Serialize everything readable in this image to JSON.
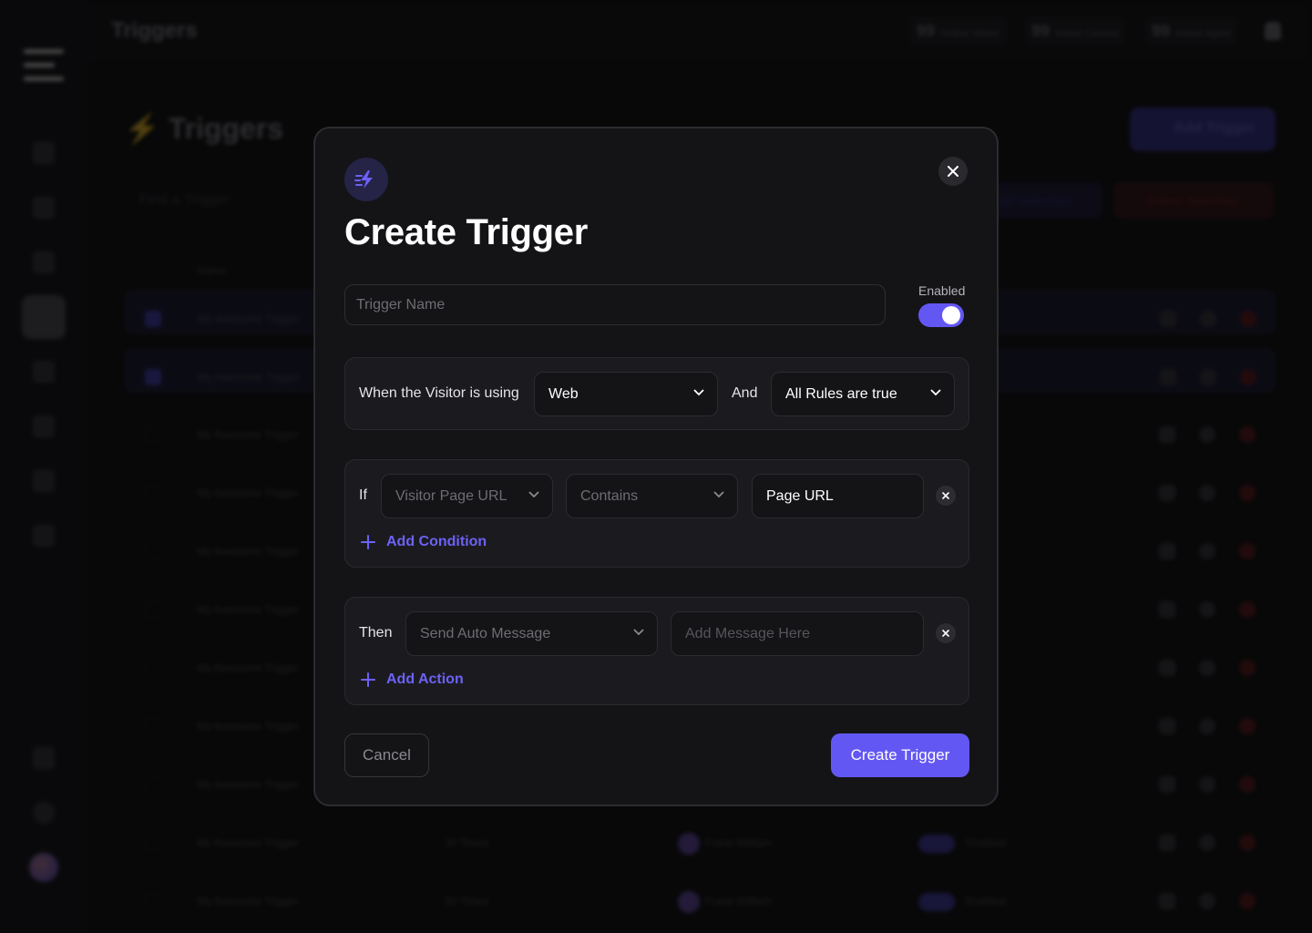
{
  "background": {
    "topbar": {
      "title": "Triggers",
      "stats": [
        {
          "value": "99",
          "label": "Online Visitor"
        },
        {
          "value": "99",
          "label": "Active Convos"
        },
        {
          "value": "99",
          "label": "Active Agent"
        }
      ]
    },
    "page_title": "Triggers",
    "add_trigger_label": "Add Trigger",
    "search_placeholder": "Find a Trigger",
    "select_label": "Edit Selection",
    "delete_label": "Delete Selection",
    "table_header_name": "Name",
    "rows": [
      {
        "name": "My Awesome Trigger",
        "selected": true
      },
      {
        "name": "My Awesome Trigger",
        "selected": true
      },
      {
        "name": "My Awesome Trigger",
        "selected": false
      },
      {
        "name": "My Awesome Trigger",
        "selected": false
      },
      {
        "name": "My Awesome Trigger",
        "selected": false
      },
      {
        "name": "My Awesome Trigger",
        "selected": false
      },
      {
        "name": "My Awesome Trigger",
        "selected": false
      },
      {
        "name": "My Awesome Trigger",
        "selected": false
      },
      {
        "name": "My Awesome Trigger",
        "selected": false
      },
      {
        "name": "My Awesome Trigger",
        "selected": false,
        "times": "30 Times",
        "agent": "Frank William",
        "status": "Enabled"
      },
      {
        "name": "My Awesome Trigger",
        "selected": false,
        "times": "30 Times",
        "agent": "Frank William",
        "status": "Enabled"
      }
    ]
  },
  "modal": {
    "icon": "lightning-speed-icon",
    "title": "Create Trigger",
    "trigger_name_placeholder": "Trigger Name",
    "enabled_label": "Enabled",
    "enabled": true,
    "when": {
      "label": "When the Visitor is using",
      "platform": "Web",
      "and_label": "And",
      "rule_mode": "All Rules are true"
    },
    "condition": {
      "if_label": "If",
      "field": "Visitor Page URL",
      "operator": "Contains",
      "value": "Page URL",
      "add_label": "Add Condition"
    },
    "action": {
      "then_label": "Then",
      "type": "Send Auto Message",
      "message_placeholder": "Add Message Here",
      "add_label": "Add Action"
    },
    "cancel_label": "Cancel",
    "submit_label": "Create Trigger"
  },
  "colors": {
    "accent": "#6357f3",
    "link": "#6c62f6",
    "modal_bg": "#141417",
    "panel_bg": "#1b1b1f"
  }
}
